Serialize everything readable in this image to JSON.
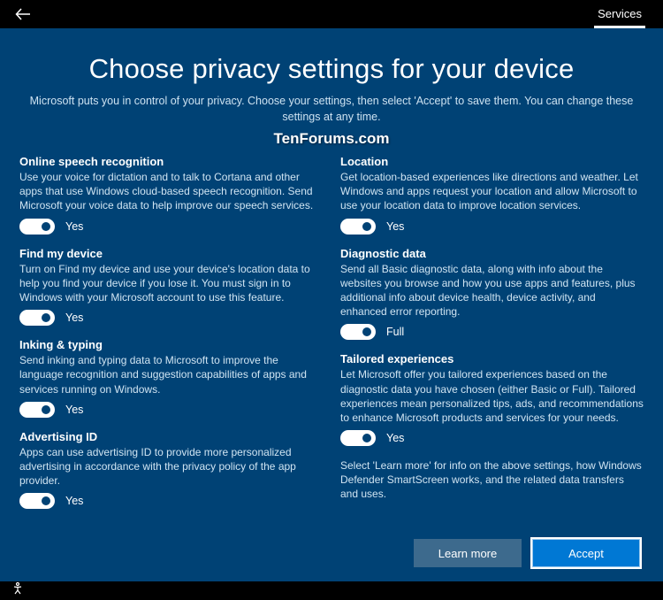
{
  "titlebar": {
    "tab": "Services"
  },
  "page": {
    "title": "Choose privacy settings for your device",
    "subtitle": "Microsoft puts you in control of your privacy. Choose your settings, then select 'Accept' to save them. You can change these settings at any time.",
    "watermark": "TenForums.com"
  },
  "left": [
    {
      "title": "Online speech recognition",
      "desc": "Use your voice for dictation and to talk to Cortana and other apps that use Windows cloud-based speech recognition. Send Microsoft your voice data to help improve our speech services.",
      "value": "Yes"
    },
    {
      "title": "Find my device",
      "desc": "Turn on Find my device and use your device's location data to help you find your device if you lose it. You must sign in to Windows with your Microsoft account to use this feature.",
      "value": "Yes"
    },
    {
      "title": "Inking & typing",
      "desc": "Send inking and typing data to Microsoft to improve the language recognition and suggestion capabilities of apps and services running on Windows.",
      "value": "Yes"
    },
    {
      "title": "Advertising ID",
      "desc": "Apps can use advertising ID to provide more personalized advertising in accordance with the privacy policy of the app provider.",
      "value": "Yes"
    }
  ],
  "right": [
    {
      "title": "Location",
      "desc": "Get location-based experiences like directions and weather. Let Windows and apps request your location and allow Microsoft to use your location data to improve location services.",
      "value": "Yes"
    },
    {
      "title": "Diagnostic data",
      "desc": "Send all Basic diagnostic data, along with info about the websites you browse and how you use apps and features, plus additional info about device health, device activity, and enhanced error reporting.",
      "value": "Full"
    },
    {
      "title": "Tailored experiences",
      "desc": "Let Microsoft offer you tailored experiences based on the diagnostic data you have chosen (either Basic or Full). Tailored experiences mean personalized tips, ads, and recommendations to enhance Microsoft products and services for your needs.",
      "value": "Yes"
    }
  ],
  "footer_note": "Select 'Learn more' for info on the above settings, how Windows Defender SmartScreen works, and the related data transfers and uses.",
  "buttons": {
    "learn_more": "Learn more",
    "accept": "Accept"
  }
}
